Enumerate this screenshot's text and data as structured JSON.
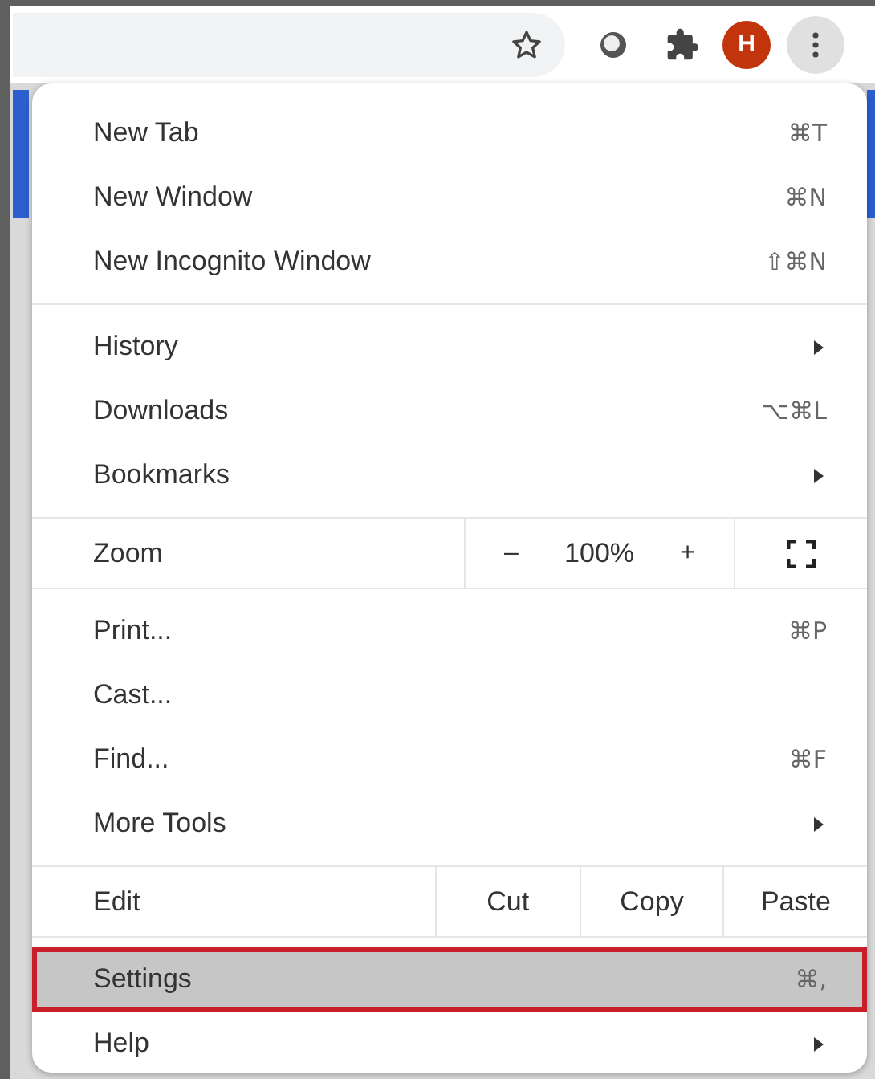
{
  "toolbar": {
    "avatar": "H"
  },
  "menu": {
    "sections": [
      {
        "kind": "items",
        "items": [
          {
            "label": "New Tab",
            "shortcut": "⌘T",
            "submenu": false,
            "selected": false
          },
          {
            "label": "New Window",
            "shortcut": "⌘N",
            "submenu": false,
            "selected": false
          },
          {
            "label": "New Incognito Window",
            "shortcut": "⇧⌘N",
            "submenu": false,
            "selected": false
          }
        ]
      },
      {
        "kind": "items",
        "items": [
          {
            "label": "History",
            "submenu": true,
            "selected": false
          },
          {
            "label": "Downloads",
            "shortcut": "⌥⌘L",
            "submenu": false,
            "selected": false
          },
          {
            "label": "Bookmarks",
            "submenu": true,
            "selected": false
          }
        ]
      },
      {
        "kind": "zoom",
        "label": "Zoom",
        "minus": "–",
        "value": "100%",
        "plus": "+"
      },
      {
        "kind": "items",
        "items": [
          {
            "label": "Print...",
            "shortcut": "⌘P",
            "submenu": false,
            "selected": false
          },
          {
            "label": "Cast...",
            "submenu": false,
            "selected": false
          },
          {
            "label": "Find...",
            "shortcut": "⌘F",
            "submenu": false,
            "selected": false
          },
          {
            "label": "More Tools",
            "submenu": true,
            "selected": false
          }
        ]
      },
      {
        "kind": "edit",
        "label": "Edit",
        "buttons": [
          "Cut",
          "Copy",
          "Paste"
        ]
      },
      {
        "kind": "items",
        "items": [
          {
            "label": "Settings",
            "shortcut": "⌘,",
            "submenu": false,
            "selected": true
          },
          {
            "label": "Help",
            "submenu": true,
            "selected": false
          }
        ]
      }
    ]
  }
}
